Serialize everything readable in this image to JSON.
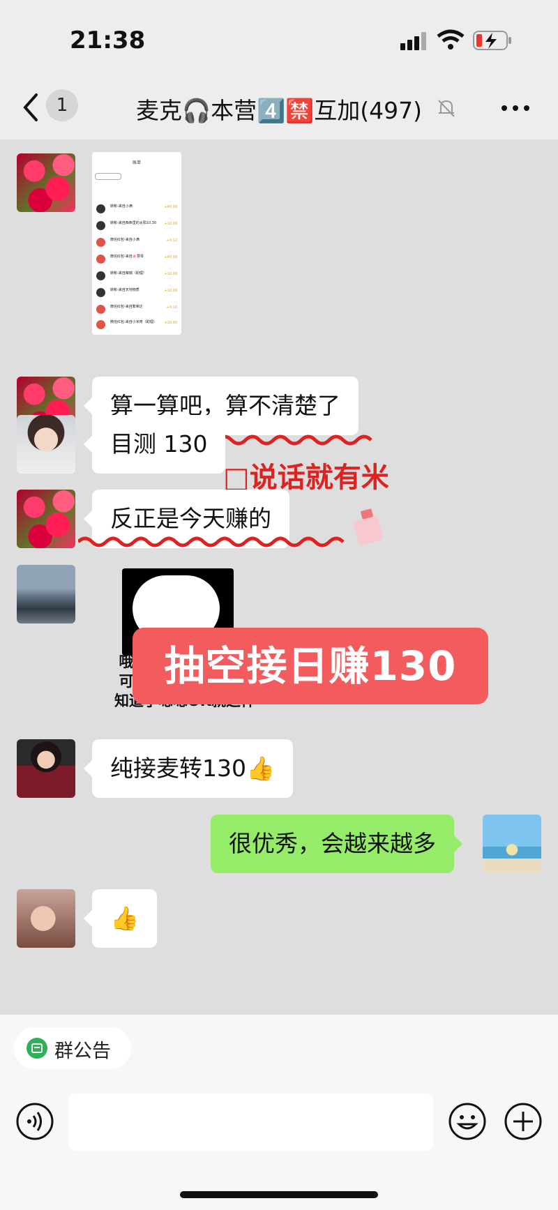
{
  "status_bar": {
    "time": "21:38"
  },
  "nav": {
    "unread_count": "1",
    "title": "麦克🎧本营4️⃣🈲互加(497)"
  },
  "messages": [
    {
      "sender": "flower",
      "type": "image"
    },
    {
      "sender": "flower",
      "type": "text",
      "text": "算一算吧，算不清楚了"
    },
    {
      "sender": "woman1",
      "type": "text",
      "text": "目测 130"
    },
    {
      "sender": "flower",
      "type": "text",
      "text": "反正是今天赚的"
    },
    {
      "sender": "sky",
      "type": "sticker",
      "caption_lines": [
        "哦好嗯嗯嗯行好好嗯",
        "可以好好好嗯嗯嗯嗯",
        "知道了嗯嗯OK就这样"
      ]
    },
    {
      "sender": "woman2",
      "type": "text",
      "text": "纯接麦转130👍"
    },
    {
      "sender": "me",
      "type": "text",
      "text": "很优秀，会越来越多"
    },
    {
      "sender": "woman3",
      "type": "text",
      "text": "👍"
    }
  ],
  "overlay": {
    "promo_text": "抽空接日赚130",
    "red_text": "□说话就有米"
  },
  "thumbnail": {
    "title": "账单",
    "rows": [
      {
        "label": "转账-来自小满",
        "amount": "+40.00"
      },
      {
        "label": "转账-来自西西里的太阳10.30",
        "amount": "+10.00"
      },
      {
        "label": "微信红包-来自小满",
        "amount": "+0.12"
      },
      {
        "label": "微信红包-来自🌸慧琴",
        "amount": "+40.00"
      },
      {
        "label": "转账-来自薇瑞（助理）",
        "amount": "+10.00"
      },
      {
        "label": "转账-来自天地物质",
        "amount": "+10.00"
      },
      {
        "label": "微信红包-来自繁荣达",
        "amount": "+0.10"
      },
      {
        "label": "微信红包-来自小米奇（助理）",
        "amount": "+10.00"
      }
    ]
  },
  "bottom": {
    "announcement_label": "群公告"
  },
  "colors": {
    "bubble_mine": "#95ec69",
    "chat_bg": "#dedede",
    "promo_bg": "#f25c5f"
  }
}
